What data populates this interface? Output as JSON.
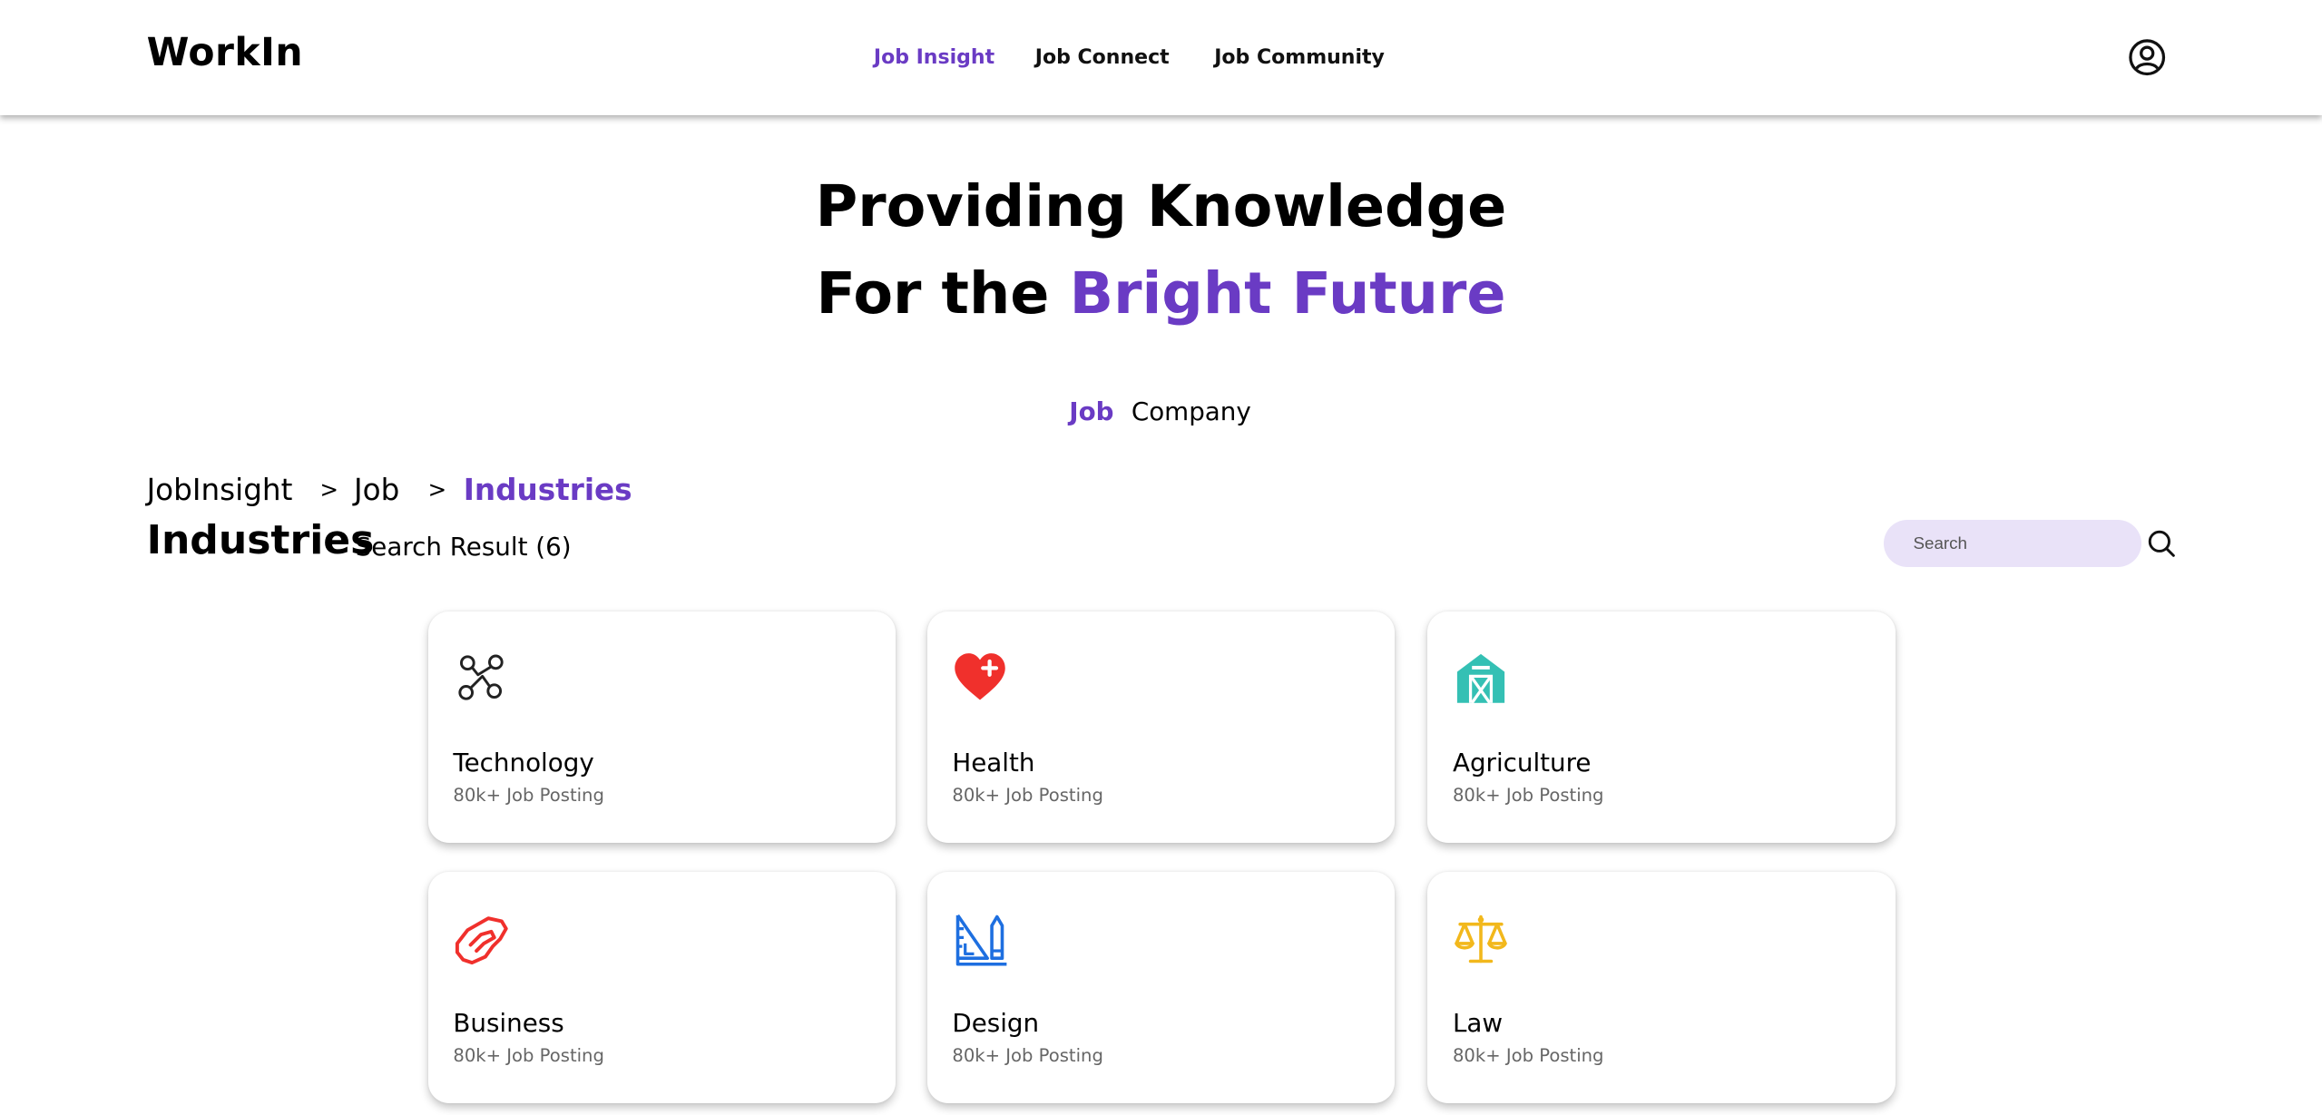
{
  "brand": {
    "logo": "WorkIn"
  },
  "nav": {
    "links": [
      "Job Insight",
      "Job Connect",
      "Job Community"
    ],
    "active": "Job Insight"
  },
  "hero": {
    "line1": "Providing Knowledge",
    "line2_prefix": "For the",
    "line2_accent": "Bright Future"
  },
  "tabs": {
    "items": [
      "Job",
      "Company"
    ],
    "active": "Job"
  },
  "breadcrumb": {
    "items": [
      "JobInsight",
      "Job",
      "Industries"
    ],
    "separator": ">"
  },
  "page": {
    "title": "Industries",
    "result_text": "Search Result (6)"
  },
  "search": {
    "placeholder": "Search"
  },
  "industries": [
    {
      "name": "Technology",
      "postings": "80k+ Job Posting",
      "icon": "route-icon",
      "color": "#222222"
    },
    {
      "name": "Health",
      "postings": "80k+ Job Posting",
      "icon": "heart-plus-icon",
      "color": "#f0302c"
    },
    {
      "name": "Agriculture",
      "postings": "80k+ Job Posting",
      "icon": "barn-icon",
      "color": "#34c0b4"
    },
    {
      "name": "Business",
      "postings": "80k+ Job Posting",
      "icon": "handshake-icon",
      "color": "#f0302c"
    },
    {
      "name": "Design",
      "postings": "80k+ Job Posting",
      "icon": "ruler-pencil-icon",
      "color": "#1e6fe0"
    },
    {
      "name": "Law",
      "postings": "80k+ Job Posting",
      "icon": "scale-icon",
      "color": "#f2b81c"
    }
  ],
  "colors": {
    "accent": "#6a3bc4",
    "search_bg": "#e9e2f8"
  }
}
